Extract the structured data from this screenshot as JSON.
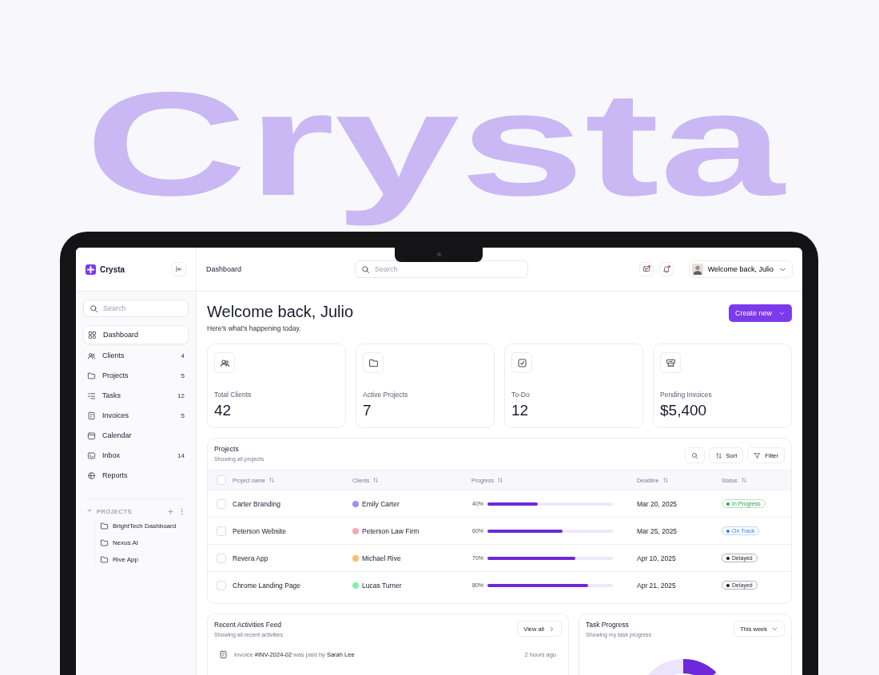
{
  "hero_text": "Crysta",
  "sidebar": {
    "logo": "Crysta",
    "search": {
      "placeholder": "Search"
    },
    "items": [
      {
        "label": "Dashboard",
        "selected": true
      },
      {
        "label": "Clients",
        "count": "4",
        "selected": false
      },
      {
        "label": "Projects",
        "count": "5",
        "selected": false
      },
      {
        "label": "Tasks",
        "count": "12",
        "selected": false
      },
      {
        "label": "Invoices",
        "count": "5",
        "selected": false
      },
      {
        "label": "Calendar",
        "selected": false
      },
      {
        "label": "Inbox",
        "count": "14",
        "selected": false
      },
      {
        "label": "Reports",
        "selected": false
      }
    ],
    "projects_section": {
      "title": "PROJECTS",
      "expanded": true,
      "items": [
        "BrightTech Dashboard",
        "Nexus AI",
        "Rive App"
      ]
    }
  },
  "header": {
    "breadcrumb": "Dashboard",
    "search": {
      "placeholder": "Search"
    },
    "user": "Welcome back, Julio"
  },
  "greeting": {
    "title": "Welcome back, Julio",
    "subtitle": "Here's what's happening today.",
    "button": "Create new"
  },
  "stats": [
    {
      "label": "Total Clients",
      "value": "42"
    },
    {
      "label": "Active Projects",
      "value": "7"
    },
    {
      "label": "To-Do",
      "value": "12"
    },
    {
      "label": "Pending Invoices",
      "value": "$5,400"
    }
  ],
  "projects": {
    "title": "Projects",
    "subtitle": "Showing all projects",
    "buttons": [
      "Sort",
      "Filter"
    ],
    "all_checked": false,
    "columns": [
      "Project name",
      "Clients",
      "Progress",
      "Deadline",
      "Status"
    ],
    "rows": [
      {
        "checked": false,
        "name": "Carter Branding",
        "client": "Emily Carter",
        "progress": "40%",
        "level": 0.4,
        "deadline": "Mar 20, 2025",
        "status": "In Progress",
        "color": "#22a447"
      },
      {
        "checked": false,
        "name": "Peterson Website",
        "client": "Peterson Law Firm",
        "progress": "60%",
        "level": 0.6,
        "deadline": "Mar 25, 2025",
        "status": "On Track",
        "color": "#2f7fe0"
      },
      {
        "checked": false,
        "name": "Revera App",
        "client": "Michael Rive",
        "progress": "70%",
        "level": 0.7,
        "deadline": "Apr 10, 2025",
        "status": "Delayed",
        "color": "#1a1a2e"
      },
      {
        "checked": false,
        "name": "Chrome Landing Page",
        "client": "Lucas Turner",
        "progress": "80%",
        "level": 0.8,
        "deadline": "Apr 21, 2025",
        "status": "Delayed",
        "color": "#1a1a2e"
      }
    ]
  },
  "activities": {
    "title": "Recent Activities Feed",
    "subtitle": "Showing all recent activities",
    "button": "View all",
    "items": [
      {
        "text": "Invoice **#INV-2024-02** was paid by **Sarah Lee**",
        "time": "2 hours ago"
      }
    ]
  },
  "task_progress": {
    "title": "Task Progress",
    "subtitle": "Showing my task progress",
    "dropdown": "This week"
  }
}
